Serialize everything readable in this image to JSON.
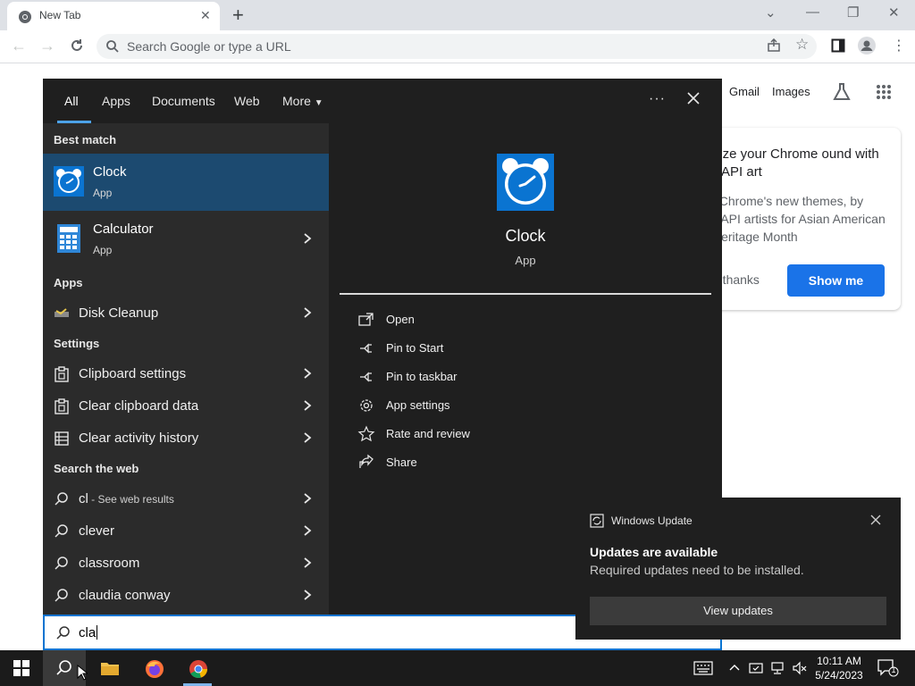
{
  "browser": {
    "tab_title": "New Tab",
    "omnibox_placeholder": "Search Google or type a URL",
    "top_links": {
      "gmail": "Gmail",
      "images": "Images"
    }
  },
  "promo": {
    "title": "nize your Chrome ound with AAPI art",
    "body": "t Chrome's new themes, by AAPI artists for Asian American Heritage Month",
    "dismiss_label": "o thanks",
    "cta_label": "Show me"
  },
  "search_panel": {
    "tabs": [
      "All",
      "Apps",
      "Documents",
      "Web",
      "More"
    ],
    "active_tab": "All",
    "best_match_heading": "Best match",
    "best_match": {
      "title": "Clock",
      "subtitle": "App"
    },
    "second_match": {
      "title": "Calculator",
      "subtitle": "App"
    },
    "apps_heading": "Apps",
    "apps": [
      {
        "label": "Disk Cleanup",
        "icon": "disk-cleanup-icon"
      }
    ],
    "settings_heading": "Settings",
    "settings": [
      {
        "label": "Clipboard settings",
        "icon": "clipboard-icon"
      },
      {
        "label": "Clear clipboard data",
        "icon": "clipboard-icon"
      },
      {
        "label": "Clear activity history",
        "icon": "activity-history-icon"
      }
    ],
    "web_heading": "Search the web",
    "web_results": [
      {
        "label": "cl",
        "suffix": " - See web results"
      },
      {
        "label": "clever",
        "suffix": ""
      },
      {
        "label": "classroom",
        "suffix": ""
      },
      {
        "label": "claudia conway",
        "suffix": ""
      }
    ],
    "detail": {
      "title": "Clock",
      "subtitle": "App",
      "actions": [
        {
          "label": "Open",
          "icon": "open-icon"
        },
        {
          "label": "Pin to Start",
          "icon": "pin-icon"
        },
        {
          "label": "Pin to taskbar",
          "icon": "pin-icon"
        },
        {
          "label": "App settings",
          "icon": "gear-icon"
        },
        {
          "label": "Rate and review",
          "icon": "star-icon"
        },
        {
          "label": "Share",
          "icon": "share-icon"
        }
      ]
    },
    "query": "cla"
  },
  "notification": {
    "app": "Windows Update",
    "title": "Updates are available",
    "body": "Required updates need to be installed.",
    "button": "View updates"
  },
  "taskbar": {
    "time": "10:11 AM",
    "date": "5/24/2023",
    "notification_count": "1"
  },
  "colors": {
    "accent": "#0a74d1",
    "selected_row": "#1c4a70",
    "panel_bg": "#1f1f1f",
    "left_col_bg": "#2b2b2b",
    "chrome_blue": "#1a73e8"
  }
}
